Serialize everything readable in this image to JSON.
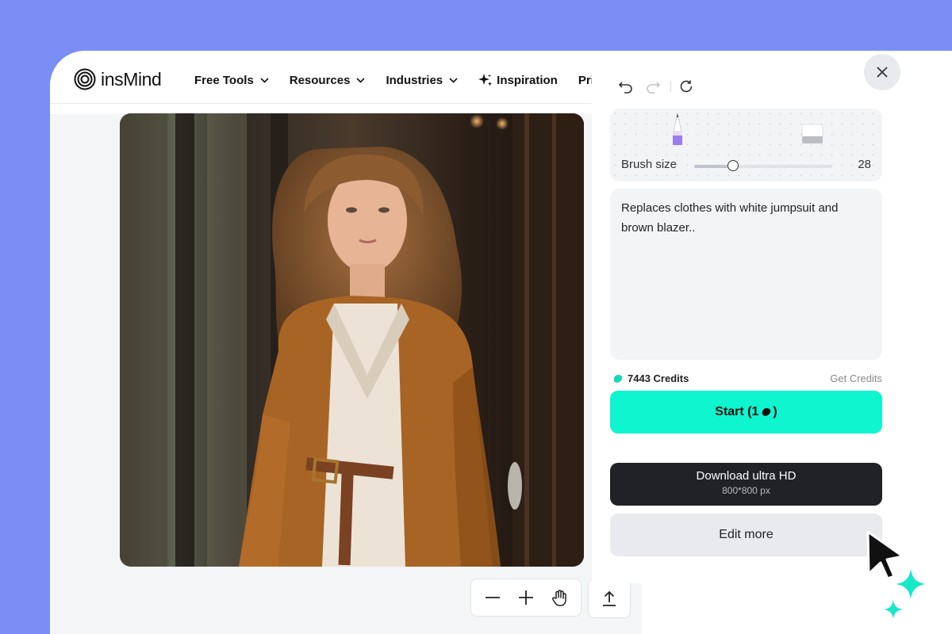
{
  "brand": {
    "name": "insMind"
  },
  "nav": {
    "items": [
      {
        "label": "Free Tools"
      },
      {
        "label": "Resources"
      },
      {
        "label": "Industries"
      },
      {
        "label": "Inspiration"
      },
      {
        "label": "Pricing"
      }
    ]
  },
  "editor": {
    "brush": {
      "label": "Brush size",
      "value": "28",
      "level": 0.28
    },
    "prompt": {
      "text": "Replaces clothes with white jumpsuit and brown blazer.."
    },
    "credits": {
      "label": "7443 Credits",
      "get_label": "Get Credits"
    },
    "start": {
      "label_prefix": "Start (1",
      "label_suffix": ")"
    },
    "download": {
      "label": "Download ultra HD",
      "resolution": "800*800 px"
    },
    "edit_more": {
      "label": "Edit more"
    }
  },
  "colors": {
    "background": "#7b8ef5",
    "accent": "#0ff5cf",
    "dark": "#202227"
  }
}
